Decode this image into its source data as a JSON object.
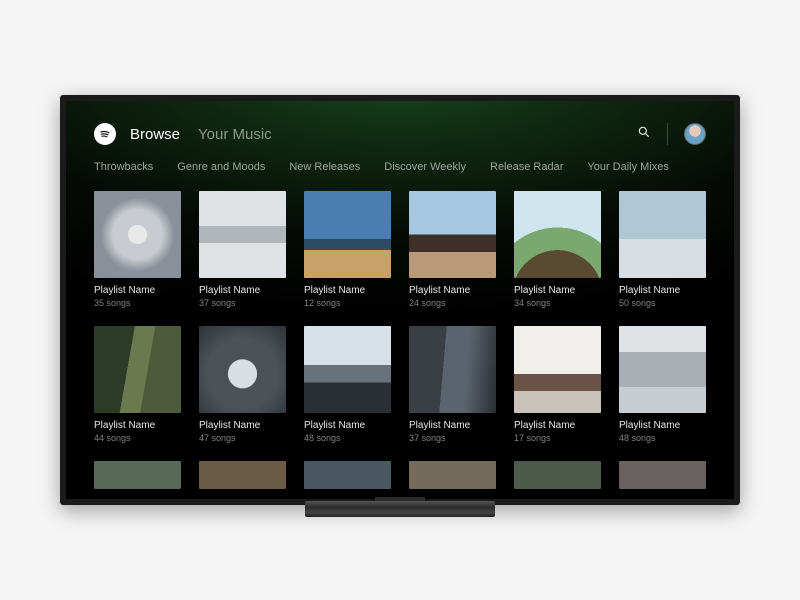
{
  "nav": {
    "active": "Browse",
    "inactive": "Your Music"
  },
  "subnav": [
    "Throwbacks",
    "Genre and Moods",
    "New Releases",
    "Discover Weekly",
    "Release Radar",
    "Your Daily Mixes"
  ],
  "playlists": [
    {
      "title": "Playlist Name",
      "count": "35 songs"
    },
    {
      "title": "Playlist Name",
      "count": "37 songs"
    },
    {
      "title": "Playlist Name",
      "count": "12 songs"
    },
    {
      "title": "Playlist Name",
      "count": "24 songs"
    },
    {
      "title": "Playlist Name",
      "count": "34 songs"
    },
    {
      "title": "Playlist Name",
      "count": "50 songs"
    },
    {
      "title": "Playlist Name",
      "count": "44 songs"
    },
    {
      "title": "Playlist Name",
      "count": "47 songs"
    },
    {
      "title": "Playlist Name",
      "count": "48 songs"
    },
    {
      "title": "Playlist Name",
      "count": "37 songs"
    },
    {
      "title": "Playlist Name",
      "count": "17 songs"
    },
    {
      "title": "Playlist Name",
      "count": "48 songs"
    }
  ]
}
